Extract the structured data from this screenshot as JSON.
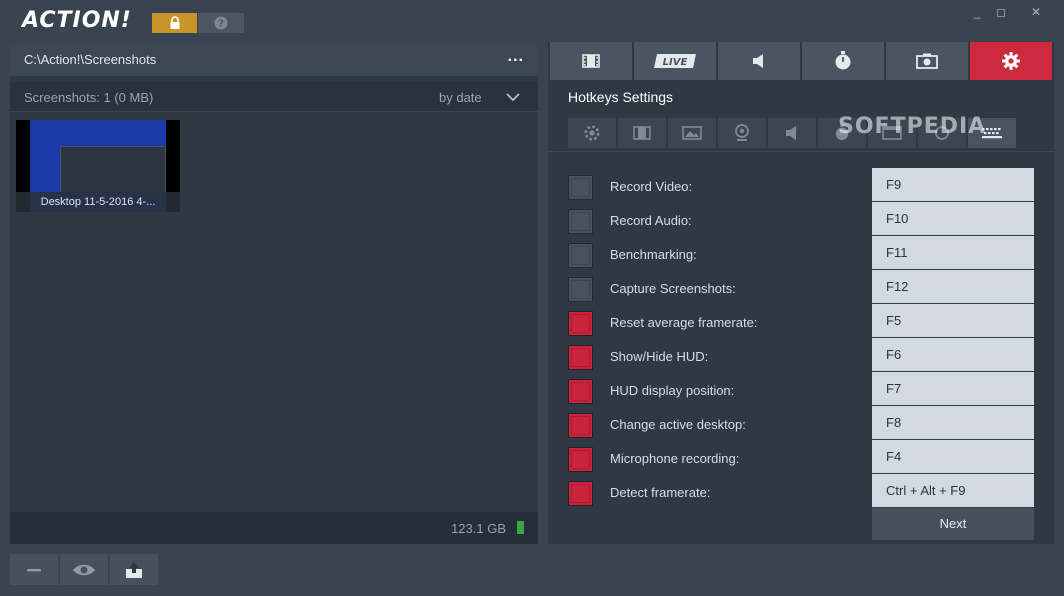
{
  "app": {
    "logo_text": "ACTION!"
  },
  "window_controls": {
    "minimize": "_",
    "restore": "◻",
    "close": "✕"
  },
  "left": {
    "path": "C:\\Action!\\Screenshots",
    "more_label": "...",
    "shots_count": "Screenshots: 1 (0 MB)",
    "sort_label": "by date",
    "thumbnails": [
      {
        "caption": "Desktop 11-5-2016 4-..."
      }
    ],
    "storage_free": "123.1 GB"
  },
  "right": {
    "main_tabs": [
      {
        "name": "video-tab",
        "icon": "film-icon"
      },
      {
        "name": "live-tab",
        "label": "LIVE"
      },
      {
        "name": "audio-tab",
        "icon": "speaker-icon"
      },
      {
        "name": "benchmark-tab",
        "icon": "stopwatch-icon"
      },
      {
        "name": "screenshot-tab",
        "icon": "camera-icon"
      },
      {
        "name": "settings-tab",
        "icon": "gear-icon",
        "active": true
      }
    ],
    "title": "Hotkeys Settings",
    "watermark": "SOFTPEDIA",
    "hotkeys": [
      {
        "label": "Record Video:",
        "key": "F9",
        "enabled": false
      },
      {
        "label": "Record Audio:",
        "key": "F10",
        "enabled": false
      },
      {
        "label": "Benchmarking:",
        "key": "F11",
        "enabled": false
      },
      {
        "label": "Capture Screenshots:",
        "key": "F12",
        "enabled": false
      },
      {
        "label": "Reset average framerate:",
        "key": "F5",
        "enabled": true
      },
      {
        "label": "Show/Hide HUD:",
        "key": "F6",
        "enabled": true
      },
      {
        "label": "HUD display position:",
        "key": "F7",
        "enabled": true
      },
      {
        "label": "Change active desktop:",
        "key": "F8",
        "enabled": true
      },
      {
        "label": "Microphone recording:",
        "key": "F4",
        "enabled": true
      },
      {
        "label": "Detect framerate:",
        "key": "Ctrl + Alt + F9",
        "enabled": true
      }
    ],
    "next_label": "Next"
  },
  "colors": {
    "accent": "#cc2a3f",
    "lock": "#c8952a",
    "background": "#3a4450",
    "panel": "#2f3843"
  }
}
